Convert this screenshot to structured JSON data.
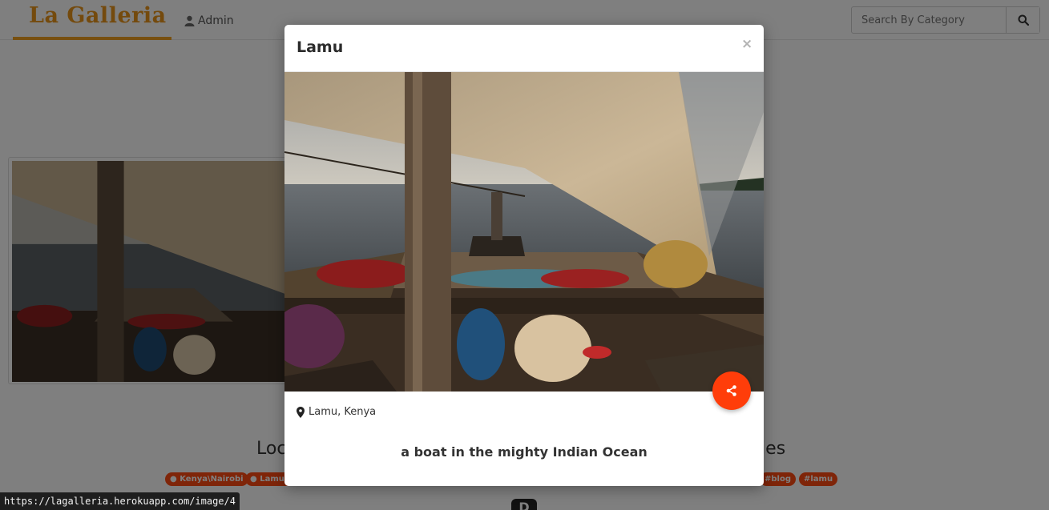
{
  "navbar": {
    "brand": "La Galleria",
    "admin_label": "Admin",
    "search_placeholder": "Search By Category",
    "user_icon": "user-icon",
    "search_icon": "search-icon"
  },
  "section": {
    "heading_left": "Loc",
    "heading_right": "ries"
  },
  "tags": [
    "Kenya\\Nairobi",
    "Lamu,",
    "#blog",
    "#lamu"
  ],
  "footer_logo": "D",
  "modal": {
    "title": "Lamu",
    "close_label": "×",
    "image_alt": "a boat in the mighty Indian Ocean",
    "location": "Lamu, Kenya",
    "caption": "a boat in the mighty Indian Ocean",
    "share_icon": "share-icon",
    "pin_icon": "map-marker-icon"
  },
  "status_bar": {
    "url": "https://lagalleria.herokuapp.com/image/4"
  },
  "colors": {
    "brand": "#e8951a",
    "accent": "#ff3d0a",
    "tag": "#ff4a12"
  }
}
